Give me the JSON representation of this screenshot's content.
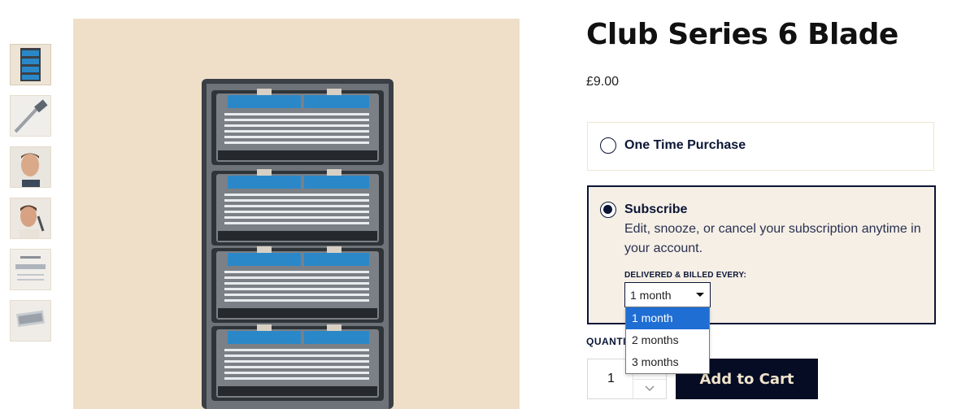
{
  "gallery": {
    "thumbnails": [
      {
        "label": "blade-cartridges-pack-thumbnail",
        "active": true
      },
      {
        "label": "razor-handle-thumbnail",
        "active": false
      },
      {
        "label": "man-shaving-thumbnail",
        "active": false
      },
      {
        "label": "man-holding-razor-thumbnail",
        "active": false
      },
      {
        "label": "blade-infographic-thumbnail",
        "active": false
      },
      {
        "label": "cartridge-detail-thumbnail",
        "active": false
      }
    ],
    "background_color": "#efdfc8",
    "accent_blue": "#2b88c8"
  },
  "product": {
    "title": "Club Series 6 Blade",
    "price": "£9.00"
  },
  "purchase_options": {
    "one_time": {
      "label": "One Time Purchase",
      "selected": false
    },
    "subscribe": {
      "label": "Subscribe",
      "selected": true,
      "description": "Edit, snooze, or cancel your subscription anytime in your account.",
      "frequency_label": "DELIVERED & BILLED EVERY:",
      "frequency_value": "1 month",
      "frequency_options": [
        "1 month",
        "2 months",
        "3 months"
      ]
    }
  },
  "quantity": {
    "label": "QUANTITY",
    "value": "1"
  },
  "cart": {
    "add_label": "Add to Cart"
  },
  "colors": {
    "navy": "#0b1536",
    "button_bg": "#060c24",
    "button_text": "#efe3cc",
    "dropdown_highlight": "#1f6ed4"
  }
}
